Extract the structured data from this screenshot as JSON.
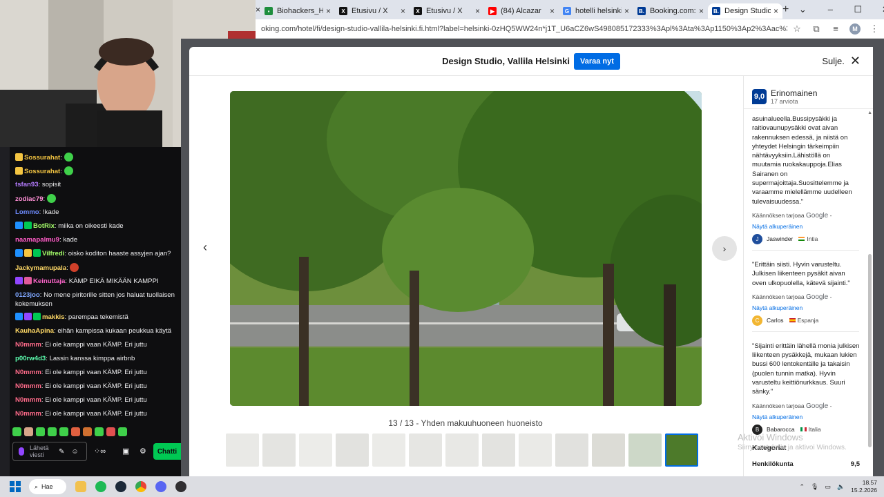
{
  "browser": {
    "tabs": [
      {
        "label": "Biohackers_Han",
        "color": "#1e8e3e",
        "glyph": "▪"
      },
      {
        "label": "Etusivu / X",
        "color": "#111111",
        "glyph": "X"
      },
      {
        "label": "Etusivu / X",
        "color": "#111111",
        "glyph": "X"
      },
      {
        "label": "(84) Alcazar",
        "color": "#ff0000",
        "glyph": "▶"
      },
      {
        "label": "hotelli helsinki -",
        "color": "#4285f4",
        "glyph": "G"
      },
      {
        "label": "Booking.com: H",
        "color": "#003b95",
        "glyph": "B."
      },
      {
        "label": "Design Studio, V",
        "color": "#003b95",
        "glyph": "B."
      }
    ],
    "new_tab": "+",
    "url": "oking.com/hotel/fi/design-studio-vallila-helsinki.fi.html?label=helsinki-0zHQ5WW24n*j1T_U6aCZ6wS498085172333%3Apl%3Ata%3Ap1150%3Ap2%3Aac%3Aap%3Aneg%3Afi%3Ati...",
    "profile_initial": "M"
  },
  "modal": {
    "hotel_name": "Design Studio, Vallila Helsinki",
    "book_label": "Varaa nyt",
    "close_label": "Sulje.",
    "caption": "13 / 13 - Yhden makuuhuoneen huoneisto",
    "thumbnail_count": 13,
    "selected_thumbnail": 13
  },
  "reviews": {
    "score": "9,0",
    "label": "Erinomainen",
    "count": "17 arviota",
    "items": [
      {
        "text": "asuinalueella.Bussipysäkki ja raitiovaunupysäkki ovat aivan rakennuksen edessä, ja niistä on yhteydet Helsingin tärkeimpiin nähtävyyksiin.Lähistöllä on muutamia ruokakauppoja.Elias Sairanen on supermajoittaja.Suosittelemme ja varaamme mielellämme uudelleen tulevaisuudessa.\"",
        "translated_by": "Käännöksen tarjoaa",
        "google": "Google",
        "show_original": "Näytä alkuperäinen",
        "name": "Jaswinder",
        "initial": "J",
        "avatar_color": "#1f4e9c",
        "country": "Intia"
      },
      {
        "text": "\"Erittäin siisti. Hyvin varusteltu. Julkisen liikenteen pysäkit aivan oven ulkopuolella, kätevä sijainti.\"",
        "translated_by": "Käännöksen tarjoaa",
        "google": "Google",
        "show_original": "Näytä alkuperäinen",
        "name": "Carlos",
        "initial": "C",
        "avatar_color": "#f2b632",
        "country": "Espanja"
      },
      {
        "text": "\"Sijainti erittäin lähellä monia julkisen liikenteen pysäkkejä, mukaan lukien bussi 600 lentokentälle ja takaisin (puolen tunnin matka). Hyvin varusteltu keittiönurkkaus. Suuri sänky.\"",
        "translated_by": "Käännöksen tarjoaa",
        "google": "Google",
        "show_original": "Näytä alkuperäinen",
        "name": "Babarocca",
        "initial": "B",
        "avatar_color": "#222222",
        "country": "Italia"
      }
    ],
    "categories_title": "Kategoriat",
    "category": {
      "name": "Henkilökunta",
      "score": "9,5"
    }
  },
  "watermark": {
    "line1": "Aktivoi Windows",
    "line2": "Siirry asetuksiin ja aktivoi Windows."
  },
  "chat": {
    "messages": [
      {
        "user": "Sossurahat",
        "color": "#f4c542",
        "text": ":"
      },
      {
        "user": "Sossurahat",
        "color": "#f4c542",
        "text": ":"
      },
      {
        "user": "tsfan93",
        "color": "#b57cff",
        "text": ": sopisit"
      },
      {
        "user": "zodiac79",
        "color": "#ff8fd6",
        "text": ":"
      },
      {
        "user": "Lommo",
        "color": "#6f8cff",
        "text": ": !kade"
      },
      {
        "user": "BotRix",
        "color": "#a6ff6b",
        "text": ": miika on oikeesti kade"
      },
      {
        "user": "naamapalmu9",
        "color": "#ff5cc8",
        "text": ": kade"
      },
      {
        "user": "Vilfredi",
        "color": "#a6ff6b",
        "text": ": oisko koditon haaste assyjen ajan?"
      },
      {
        "user": "Jackymamupala",
        "color": "#ffd966",
        "text": ":"
      },
      {
        "user": "Keinuttaja",
        "color": "#ff66cc",
        "text": ": KÄMP EIKÄ MIKÄÄN KAMPPI"
      },
      {
        "user": "0123joo",
        "color": "#7fa7ff",
        "text": ": No mene piritorille sitten jos haluat tuollaisen kokemuksen"
      },
      {
        "user": "makkis",
        "color": "#ffd966",
        "text": ": parempaa tekemistä"
      },
      {
        "user": "KauhaApina",
        "color": "#ffd966",
        "text": ": eihän kampissa kukaan peukkua käytä"
      },
      {
        "user": "N0mmm",
        "color": "#ff6b8a",
        "text": ": Ei ole kamppi vaan KÄMP. Eri juttu"
      },
      {
        "user": "p00rw4d3",
        "color": "#5cffb0",
        "text": ": Lassin kanssa kimppa airbnb"
      },
      {
        "user": "N0mmm",
        "color": "#ff6b8a",
        "text": ": Ei ole kamppi vaan KÄMP. Eri juttu"
      },
      {
        "user": "N0mmm",
        "color": "#ff6b8a",
        "text": ": Ei ole kamppi vaan KÄMP. Eri juttu"
      },
      {
        "user": "N0mmm",
        "color": "#ff6b8a",
        "text": ": Ei ole kamppi vaan KÄMP. Eri juttu"
      },
      {
        "user": "N0mmm",
        "color": "#ff6b8a",
        "text": ": Ei ole kamppi vaan KÄMP. Eri juttu"
      }
    ],
    "input_placeholder": "Lähetä viesti",
    "send_label": "Chatti"
  },
  "taskbar": {
    "search_label": "Hae",
    "time": "18.57",
    "date": "15.2.2026"
  }
}
